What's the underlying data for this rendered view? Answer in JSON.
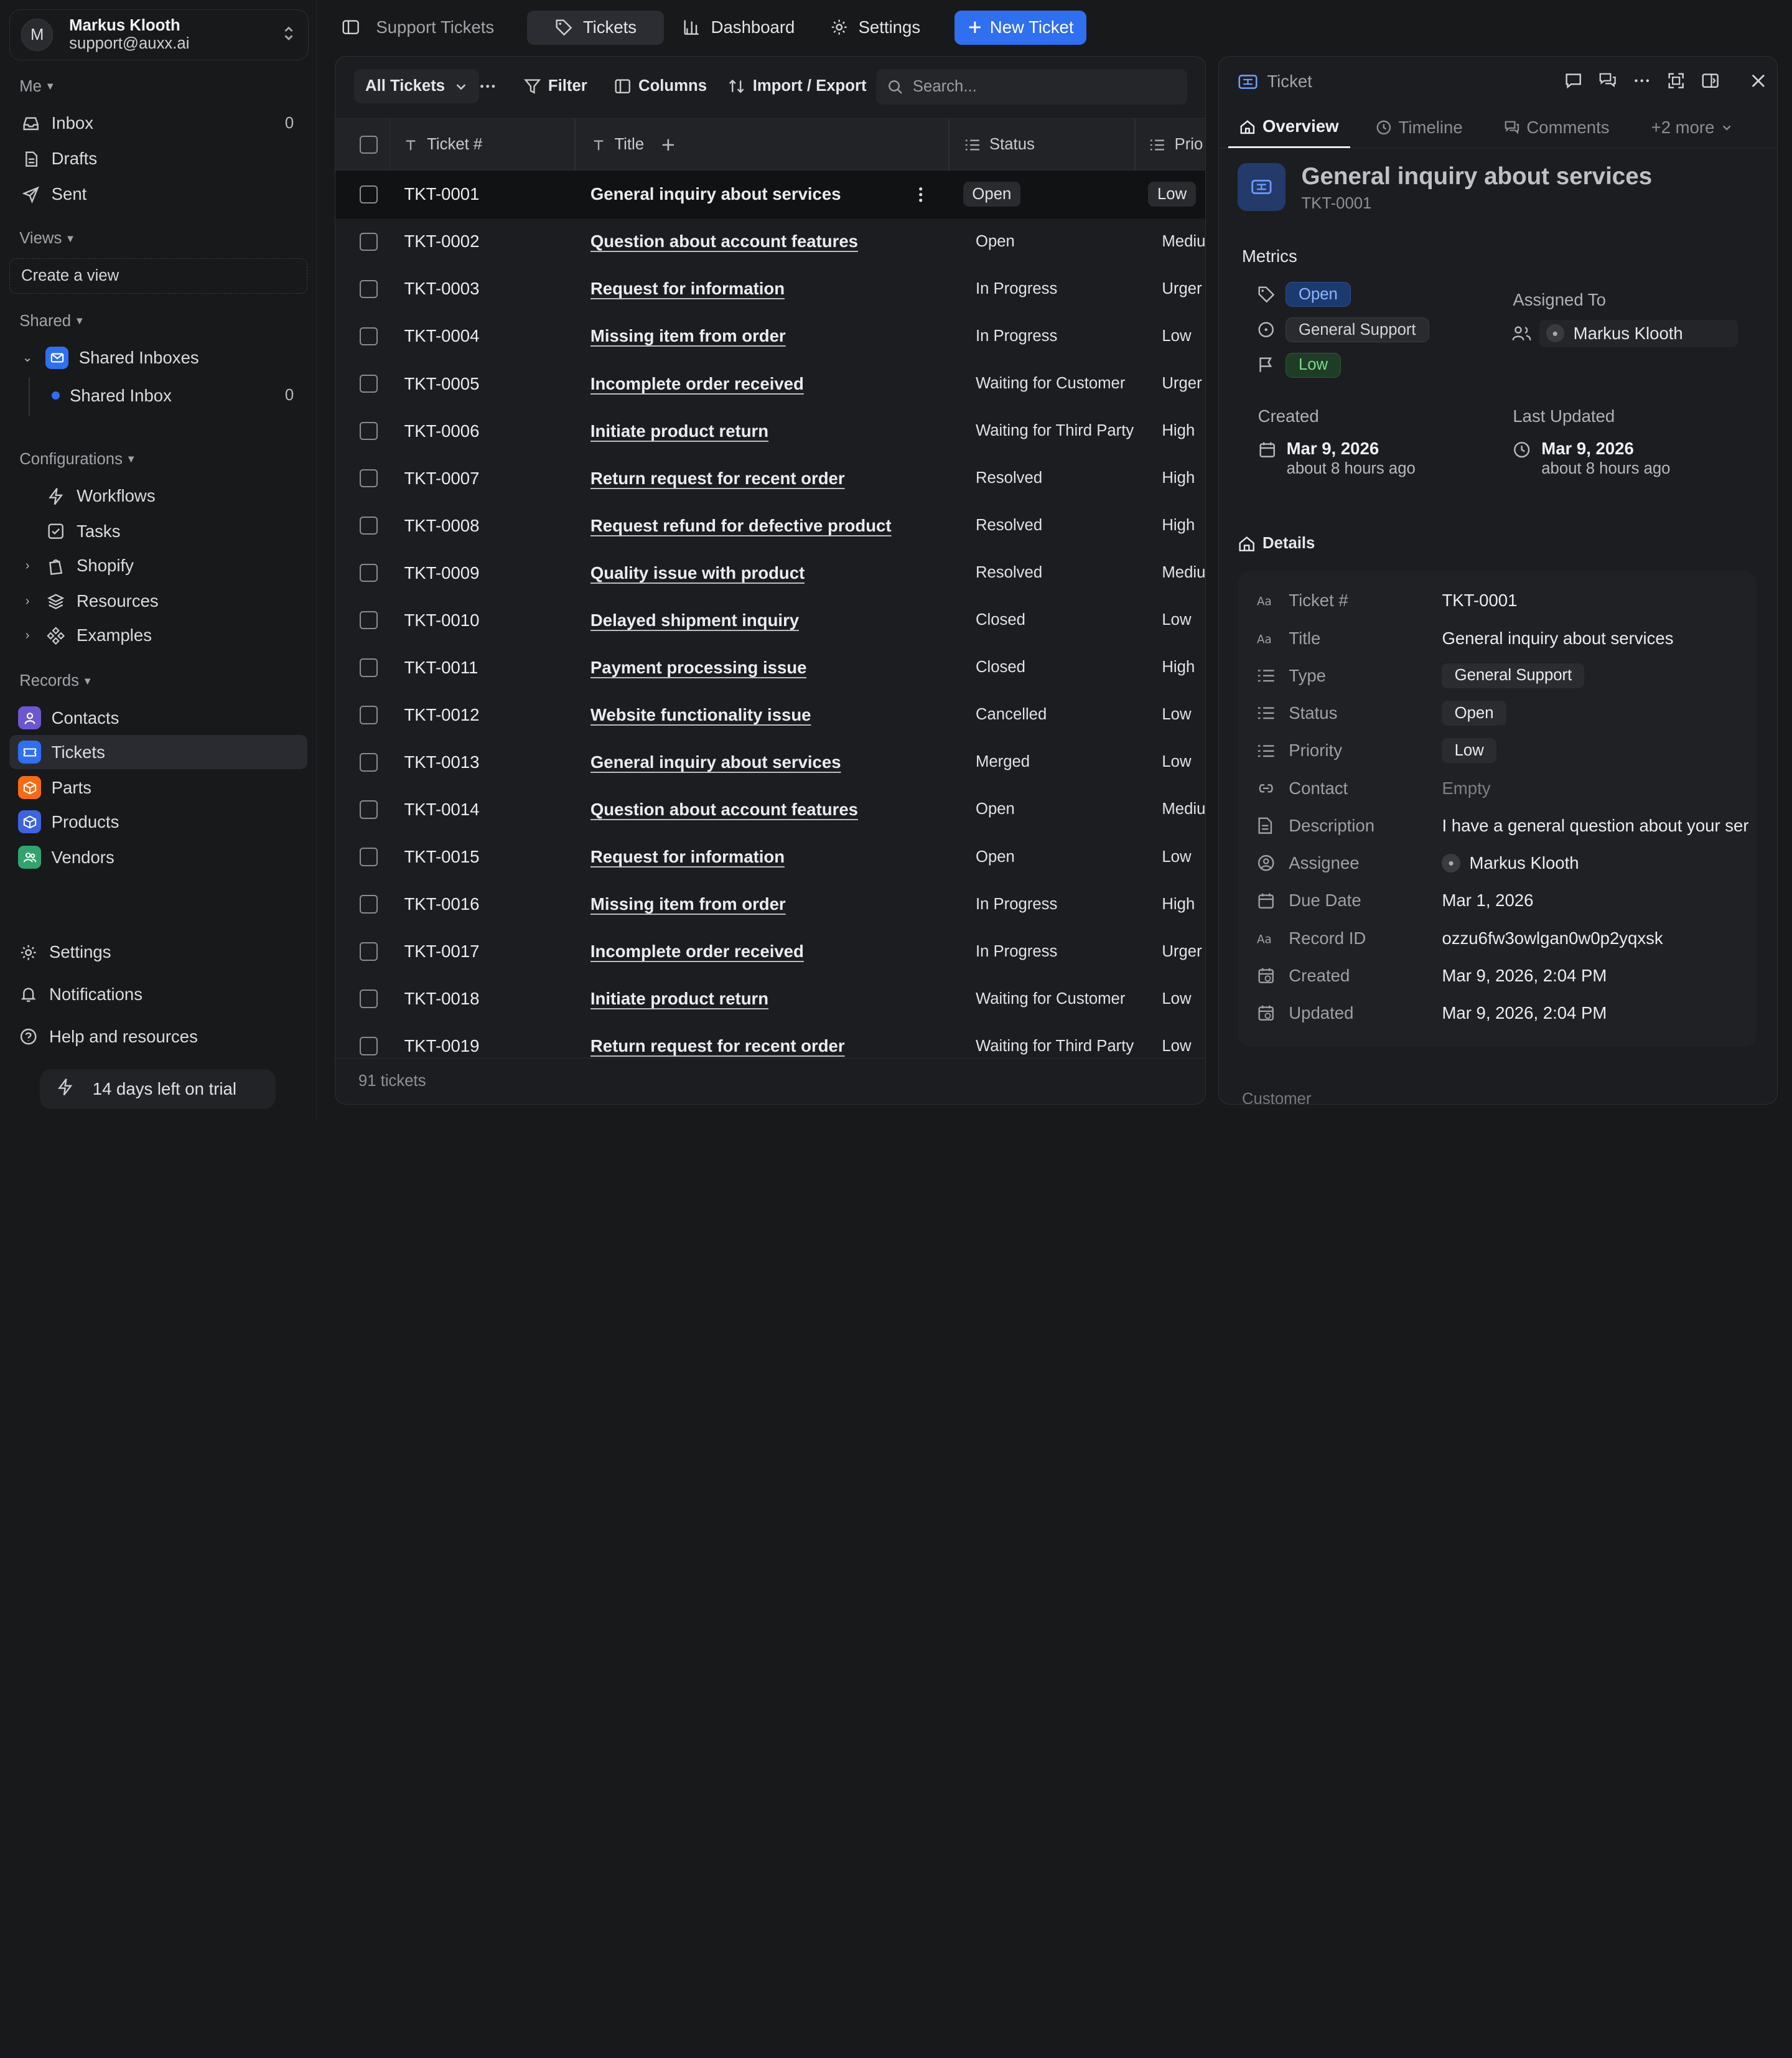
{
  "account": {
    "initial": "M",
    "name": "Markus Klooth",
    "email": "support@auxx.ai"
  },
  "sidebar": {
    "me_label": "Me",
    "me_items": [
      {
        "label": "Inbox",
        "count": "0",
        "icon": "inbox-icon"
      },
      {
        "label": "Drafts",
        "count": "",
        "icon": "drafts-icon"
      },
      {
        "label": "Sent",
        "count": "",
        "icon": "send-icon"
      }
    ],
    "views_label": "Views",
    "create_view": "Create a view",
    "shared_label": "Shared",
    "shared_inboxes": "Shared Inboxes",
    "shared_inbox": {
      "label": "Shared Inbox",
      "count": "0"
    },
    "configurations_label": "Configurations",
    "config_items": [
      {
        "label": "Workflows",
        "icon": "lightning-icon"
      },
      {
        "label": "Tasks",
        "icon": "checkbox-icon"
      },
      {
        "label": "Shopify",
        "icon": "shopify-icon"
      },
      {
        "label": "Resources",
        "icon": "layers-icon"
      },
      {
        "label": "Examples",
        "icon": "components-icon"
      }
    ],
    "records_label": "Records",
    "records_items": [
      {
        "label": "Contacts",
        "color": "#6e56cf"
      },
      {
        "label": "Tickets",
        "color": "#2f6ff0"
      },
      {
        "label": "Parts",
        "color": "#f76b15"
      },
      {
        "label": "Products",
        "color": "#3e63dd"
      },
      {
        "label": "Vendors",
        "color": "#30a46c"
      }
    ],
    "footer_items": [
      {
        "label": "Settings",
        "icon": "gear-icon"
      },
      {
        "label": "Notifications",
        "icon": "bell-icon"
      },
      {
        "label": "Help and resources",
        "icon": "help-icon"
      }
    ],
    "trial": "14 days left on trial"
  },
  "topbar": {
    "breadcrumb": "Support Tickets",
    "tabs": [
      "Tickets",
      "Dashboard",
      "Settings"
    ],
    "new_ticket": "New Ticket"
  },
  "toolbar": {
    "view": "All Tickets",
    "filter": "Filter",
    "columns": "Columns",
    "import_export": "Import / Export",
    "search_placeholder": "Search..."
  },
  "table": {
    "headers": {
      "ticket": "Ticket #",
      "title": "Title",
      "status": "Status",
      "priority": "Prio"
    },
    "rows": [
      {
        "id": "TKT-0001",
        "title": "General inquiry about services",
        "status": "Open",
        "priority": "Low"
      },
      {
        "id": "TKT-0002",
        "title": "Question about account features",
        "status": "Open",
        "priority": "Mediu"
      },
      {
        "id": "TKT-0003",
        "title": "Request for information",
        "status": "In Progress",
        "priority": "Urger"
      },
      {
        "id": "TKT-0004",
        "title": "Missing item from order",
        "status": "In Progress",
        "priority": "Low"
      },
      {
        "id": "TKT-0005",
        "title": "Incomplete order received",
        "status": "Waiting for Customer",
        "priority": "Urger"
      },
      {
        "id": "TKT-0006",
        "title": "Initiate product return",
        "status": "Waiting for Third Party",
        "priority": "High"
      },
      {
        "id": "TKT-0007",
        "title": "Return request for recent order",
        "status": "Resolved",
        "priority": "High"
      },
      {
        "id": "TKT-0008",
        "title": "Request refund for defective product",
        "status": "Resolved",
        "priority": "High"
      },
      {
        "id": "TKT-0009",
        "title": "Quality issue with product",
        "status": "Resolved",
        "priority": "Mediu"
      },
      {
        "id": "TKT-0010",
        "title": "Delayed shipment inquiry",
        "status": "Closed",
        "priority": "Low"
      },
      {
        "id": "TKT-0011",
        "title": "Payment processing issue",
        "status": "Closed",
        "priority": "High"
      },
      {
        "id": "TKT-0012",
        "title": "Website functionality issue",
        "status": "Cancelled",
        "priority": "Low"
      },
      {
        "id": "TKT-0013",
        "title": "General inquiry about services",
        "status": "Merged",
        "priority": "Low"
      },
      {
        "id": "TKT-0014",
        "title": "Question about account features",
        "status": "Open",
        "priority": "Mediu"
      },
      {
        "id": "TKT-0015",
        "title": "Request for information",
        "status": "Open",
        "priority": "Low"
      },
      {
        "id": "TKT-0016",
        "title": "Missing item from order",
        "status": "In Progress",
        "priority": "High"
      },
      {
        "id": "TKT-0017",
        "title": "Incomplete order received",
        "status": "In Progress",
        "priority": "Urger"
      },
      {
        "id": "TKT-0018",
        "title": "Initiate product return",
        "status": "Waiting for Customer",
        "priority": "Low"
      },
      {
        "id": "TKT-0019",
        "title": "Return request for recent order",
        "status": "Waiting for Third Party",
        "priority": "Low"
      }
    ],
    "footer": "91 tickets"
  },
  "detail": {
    "header_label": "Ticket",
    "tabs": [
      "Overview",
      "Timeline",
      "Comments",
      "+2 more"
    ],
    "title": "General inquiry about services",
    "subtitle": "TKT-0001",
    "metrics_label": "Metrics",
    "status_pill": "Open",
    "type_pill": "General Support",
    "priority_pill": "Low",
    "assigned_to_label": "Assigned To",
    "assignee": "Markus Klooth",
    "created_label": "Created",
    "created_date": "Mar 9, 2026",
    "created_ago": "about 8 hours ago",
    "updated_label": "Last Updated",
    "updated_date": "Mar 9, 2026",
    "updated_ago": "about 8 hours ago",
    "details_label": "Details",
    "fields": [
      {
        "label": "Ticket #",
        "value": "TKT-0001",
        "chip": false,
        "icon": "text-icon"
      },
      {
        "label": "Title",
        "value": "General inquiry about services",
        "chip": false,
        "icon": "text-icon"
      },
      {
        "label": "Type",
        "value": "General Support",
        "chip": true,
        "icon": "list-icon"
      },
      {
        "label": "Status",
        "value": "Open",
        "chip": true,
        "icon": "list-icon"
      },
      {
        "label": "Priority",
        "value": "Low",
        "chip": true,
        "icon": "list-icon"
      },
      {
        "label": "Contact",
        "value": "Empty",
        "chip": false,
        "muted": true,
        "icon": "link-icon"
      },
      {
        "label": "Description",
        "value": "I have a general question about your services",
        "chip": false,
        "icon": "document-icon"
      },
      {
        "label": "Assignee",
        "value": "Markus Klooth",
        "chip": false,
        "avatar": true,
        "icon": "user-circle-icon"
      },
      {
        "label": "Due Date",
        "value": "Mar 1, 2026",
        "chip": false,
        "icon": "calendar-icon"
      },
      {
        "label": "Record ID",
        "value": "ozzu6fw3owlgan0w0p2yqxsk",
        "chip": false,
        "icon": "text-icon"
      },
      {
        "label": "Created",
        "value": "Mar 9, 2026, 2:04 PM",
        "chip": false,
        "icon": "calendar-clock-icon"
      },
      {
        "label": "Updated",
        "value": "Mar 9, 2026, 2:04 PM",
        "chip": false,
        "icon": "calendar-clock-icon"
      }
    ],
    "next_section": "Customer"
  },
  "colors": {
    "accent": "#2f6ff0",
    "status_open_bg": "#1d3a70",
    "status_open_fg": "#8fb5ff",
    "priority_low_bg": "#1f3d26",
    "priority_low_fg": "#7ed88e"
  }
}
